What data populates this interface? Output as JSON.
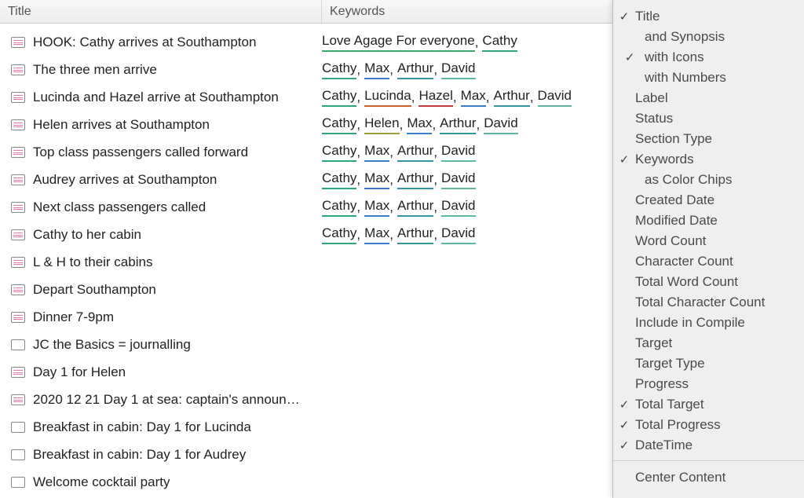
{
  "columns": {
    "title": "Title",
    "keywords": "Keywords"
  },
  "keyword_colors": {
    "Cathy": "#2fa779",
    "Max": "#3a7cc9",
    "Arthur": "#3495a2",
    "David": "#5fb7a3",
    "Lucinda": "#cf5f2a",
    "Hazel": "#c23a3a",
    "Helen": "#9d9d3c",
    "Love Agage For everyone": "#3aa86f"
  },
  "rows": [
    {
      "icon": "lines",
      "title": "HOOK: Cathy arrives at Southampton",
      "keywords": [
        "Love Agage For everyone",
        "Cathy"
      ]
    },
    {
      "icon": "lines",
      "title": "The three men arrive",
      "keywords": [
        "Cathy",
        "Max",
        "Arthur",
        "David"
      ]
    },
    {
      "icon": "lines",
      "title": "Lucinda and Hazel arrive at Southampton",
      "keywords": [
        "Cathy",
        "Lucinda",
        "Hazel",
        "Max",
        "Arthur",
        "David"
      ]
    },
    {
      "icon": "lines",
      "title": "Helen arrives at Southampton",
      "keywords": [
        "Cathy",
        "Helen",
        "Max",
        "Arthur",
        "David"
      ]
    },
    {
      "icon": "lines",
      "title": "Top class passengers called forward",
      "keywords": [
        "Cathy",
        "Max",
        "Arthur",
        "David"
      ]
    },
    {
      "icon": "lines",
      "title": "Audrey arrives at Southampton",
      "keywords": [
        "Cathy",
        "Max",
        "Arthur",
        "David"
      ]
    },
    {
      "icon": "lines",
      "title": "Next class passengers called",
      "keywords": [
        "Cathy",
        "Max",
        "Arthur",
        "David"
      ]
    },
    {
      "icon": "lines",
      "title": "Cathy to her cabin",
      "keywords": [
        "Cathy",
        "Max",
        "Arthur",
        "David"
      ]
    },
    {
      "icon": "lines",
      "title": "L & H to their cabins",
      "keywords": []
    },
    {
      "icon": "lines",
      "title": "Depart Southampton",
      "keywords": []
    },
    {
      "icon": "lines",
      "title": "Dinner 7-9pm",
      "keywords": []
    },
    {
      "icon": "box",
      "title": "JC the Basics = journalling",
      "keywords": []
    },
    {
      "icon": "lines",
      "title": " Day 1 for Helen",
      "keywords": []
    },
    {
      "icon": "lines",
      "title": "2020 12 21 Day 1 at sea: captain's announ…",
      "keywords": []
    },
    {
      "icon": "box",
      "title": "Breakfast in cabin: Day 1 for Lucinda",
      "keywords": []
    },
    {
      "icon": "box",
      "title": "Breakfast in cabin: Day 1 for Audrey",
      "keywords": []
    },
    {
      "icon": "box",
      "title": "Welcome cocktail party",
      "keywords": []
    }
  ],
  "menu": {
    "items": [
      {
        "label": "Title",
        "checked": true,
        "indent": 0
      },
      {
        "label": "and Synopsis",
        "checked": false,
        "indent": 1
      },
      {
        "label": "with Icons",
        "checked": true,
        "indent": 1
      },
      {
        "label": "with Numbers",
        "checked": false,
        "indent": 1
      },
      {
        "label": "Label",
        "checked": false,
        "indent": 0
      },
      {
        "label": "Status",
        "checked": false,
        "indent": 0
      },
      {
        "label": "Section Type",
        "checked": false,
        "indent": 0
      },
      {
        "label": "Keywords",
        "checked": true,
        "indent": 0
      },
      {
        "label": "as Color Chips",
        "checked": false,
        "indent": 1
      },
      {
        "label": "Created Date",
        "checked": false,
        "indent": 0
      },
      {
        "label": "Modified Date",
        "checked": false,
        "indent": 0
      },
      {
        "label": "Word Count",
        "checked": false,
        "indent": 0
      },
      {
        "label": "Character Count",
        "checked": false,
        "indent": 0
      },
      {
        "label": "Total Word Count",
        "checked": false,
        "indent": 0
      },
      {
        "label": "Total Character Count",
        "checked": false,
        "indent": 0
      },
      {
        "label": "Include in Compile",
        "checked": false,
        "indent": 0
      },
      {
        "label": "Target",
        "checked": false,
        "indent": 0
      },
      {
        "label": "Target Type",
        "checked": false,
        "indent": 0
      },
      {
        "label": "Progress",
        "checked": false,
        "indent": 0
      },
      {
        "label": "Total Target",
        "checked": true,
        "indent": 0
      },
      {
        "label": "Total Progress",
        "checked": true,
        "indent": 0
      },
      {
        "label": "DateTime",
        "checked": true,
        "indent": 0
      }
    ],
    "footer": "Center Content"
  }
}
